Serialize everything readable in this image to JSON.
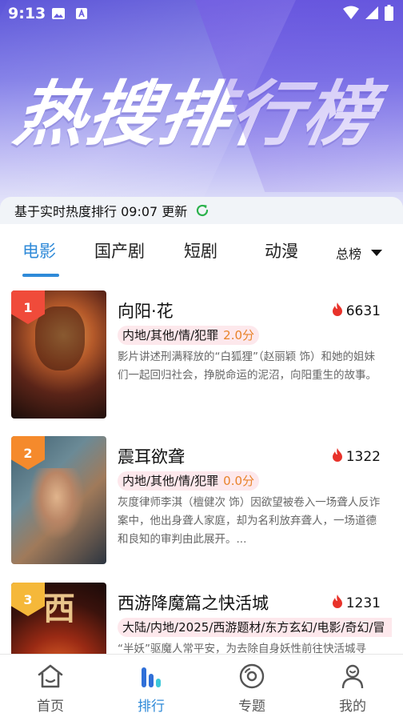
{
  "status_bar": {
    "time": "9:13"
  },
  "hero": {
    "title": "热搜排行榜"
  },
  "update_bar": {
    "text": "基于实时热度排行 09:07 更新"
  },
  "tabs": [
    {
      "label": "电影"
    },
    {
      "label": "国产剧"
    },
    {
      "label": "短剧"
    },
    {
      "label": "动漫"
    }
  ],
  "dropdown": {
    "label": "总榜"
  },
  "items": [
    {
      "rank": "1",
      "title": "向阳·花",
      "heat": "6631",
      "tags": "内地/其他/情/犯罪",
      "score": "2.0分",
      "desc": "影片讲述刑满释放的“白狐狸”（赵丽颖 饰）和她的姐妹们一起回归社会，挣脱命运的泥沼，向阳重生的故事。"
    },
    {
      "rank": "2",
      "title": "震耳欲聋",
      "heat": "1322",
      "tags": "内地/其他/情/犯罪",
      "score": "0.0分",
      "desc": "灰度律师李淇（檀健次 饰）因欲望被卷入一场聋人反诈案中，他出身聋人家庭，却为名利放弃聋人，一场道德和良知的审判由此展开。..."
    },
    {
      "rank": "3",
      "title": "西游降魔篇之快活城",
      "heat": "1231",
      "tags": "大陆/内地/2025/西游题材/东方玄幻/电影/奇幻/冒",
      "score": "",
      "desc": "“半妖”驱魔人常平安，为去除自身妖性前往快活城寻"
    }
  ],
  "bottom_nav": [
    {
      "label": "首页"
    },
    {
      "label": "排行"
    },
    {
      "label": "专题"
    },
    {
      "label": "我的"
    }
  ],
  "colors": {
    "accent": "#2f8ad8",
    "rank1": "#f04b3a",
    "rank2": "#f58a2c",
    "rank3": "#f5b83a",
    "heat": "#e8322a"
  }
}
